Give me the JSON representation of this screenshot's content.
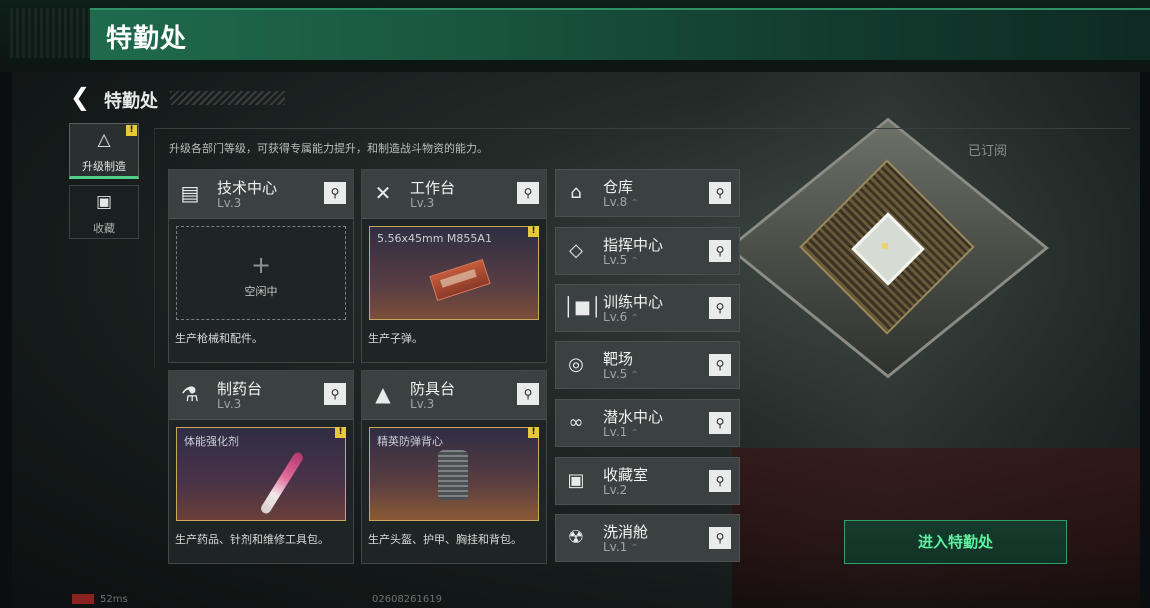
{
  "app": {
    "banner_title": "特勤处"
  },
  "header": {
    "back_label": "<",
    "title": "特勤处",
    "subscribed": "已订阅"
  },
  "description": "升级各部门等级，可获得专属能力提升，和制造战斗物资的能力。",
  "tabs": [
    {
      "label": "升级制造",
      "icon": "upgrade-icon",
      "active": true,
      "alert": true
    },
    {
      "label": "收藏",
      "icon": "collection-icon",
      "active": false,
      "alert": false
    }
  ],
  "cards": [
    {
      "name": "技术中心",
      "level": "Lv.3",
      "icon": "tech-center-icon",
      "slot_state": "idle",
      "idle_text": "空闲中",
      "item": "",
      "desc": "生产枪械和配件。"
    },
    {
      "name": "工作台",
      "level": "Lv.3",
      "icon": "workbench-icon",
      "slot_state": "item",
      "idle_text": "",
      "item": "5.56x45mm M855A1",
      "desc": "生产子弹。"
    },
    {
      "name": "制药台",
      "level": "Lv.3",
      "icon": "pharmacy-icon",
      "slot_state": "item",
      "idle_text": "",
      "item": "体能强化剂",
      "desc": "生产药品、针剂和维修工具包。"
    },
    {
      "name": "防具台",
      "level": "Lv.3",
      "icon": "armor-bench-icon",
      "slot_state": "item",
      "idle_text": "",
      "item": "精英防弹背心",
      "desc": "生产头盔、护甲、胸挂和背包。"
    }
  ],
  "rows": [
    {
      "name": "仓库",
      "level": "Lv.8",
      "icon": "warehouse-icon"
    },
    {
      "name": "指挥中心",
      "level": "Lv.5",
      "icon": "command-center-icon"
    },
    {
      "name": "训练中心",
      "level": "Lv.6",
      "icon": "training-center-icon"
    },
    {
      "name": "靶场",
      "level": "Lv.5",
      "icon": "shooting-range-icon"
    },
    {
      "name": "潜水中心",
      "level": "Lv.1",
      "icon": "diving-center-icon"
    },
    {
      "name": "收藏室",
      "level": "Lv.2",
      "icon": "collection-room-icon"
    },
    {
      "name": "洗消舱",
      "level": "Lv.1",
      "icon": "decontamination-icon"
    }
  ],
  "enter_button": "进入特勤处",
  "status": {
    "ping": "52ms",
    "player_id": "02608261619"
  },
  "colors": {
    "accent_green": "#4fcf87",
    "banner_green": "#1f6a4d",
    "alert_yellow": "#e8c93c"
  }
}
